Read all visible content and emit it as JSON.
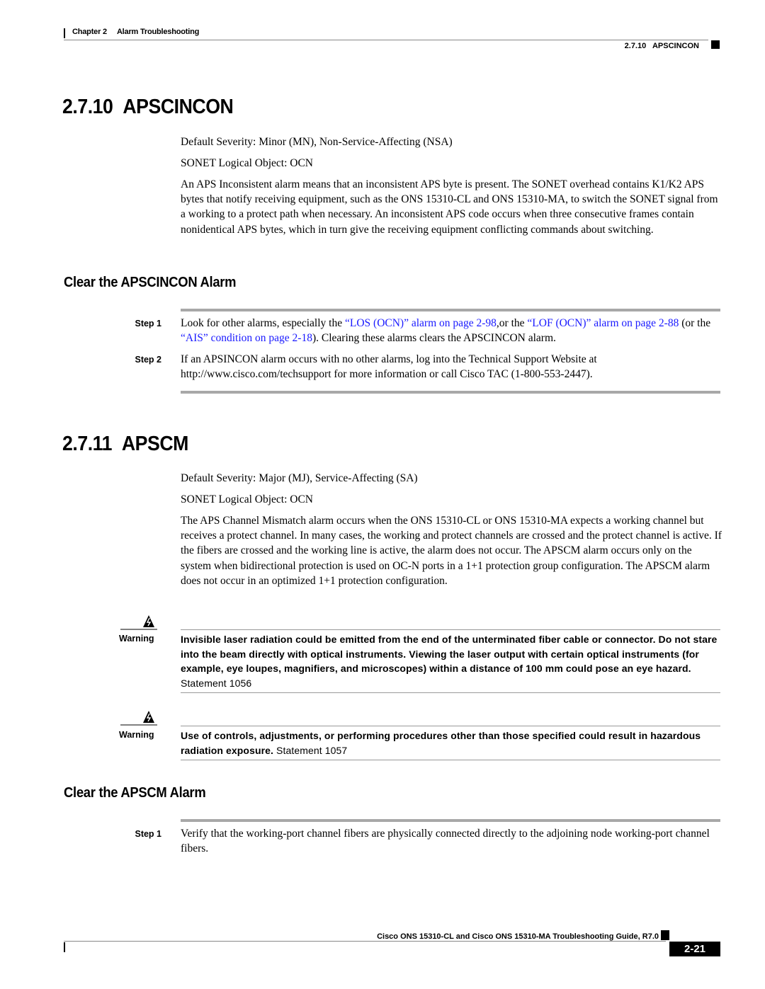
{
  "header": {
    "chapter": "Chapter 2",
    "chapter_title": "Alarm Troubleshooting",
    "running_section": "2.7.10   APSCINCON"
  },
  "sections": [
    {
      "number": "2.7.10",
      "title": "APSCINCON",
      "severity": "Default Severity: Minor (MN), Non-Service-Affecting (NSA)",
      "logical_object": "SONET Logical Object: OCN",
      "description": "An APS Inconsistent alarm means that an inconsistent APS byte is present. The SONET overhead contains K1/K2 APS bytes that notify receiving equipment, such as the ONS 15310-CL and ONS 15310-MA, to switch the SONET signal from a working to a protect path when necessary. An inconsistent APS code occurs when three consecutive frames contain nonidentical APS bytes, which in turn give the receiving equipment conflicting commands about switching.",
      "procedure": {
        "title": "Clear the APSCINCON Alarm",
        "steps": [
          {
            "label": "Step 1",
            "parts": [
              {
                "text": "Look for other alarms, especially the ",
                "link": false
              },
              {
                "text": "“LOS (OCN)” alarm on page 2-98",
                "link": true
              },
              {
                "text": ",or the ",
                "link": false
              },
              {
                "text": "“LOF (OCN)” alarm on page 2-88",
                "link": true
              },
              {
                "text": " (or the ",
                "link": false
              },
              {
                "text": "“AIS” condition on page 2-18",
                "link": true
              },
              {
                "text": "). Clearing these alarms clears the APSCINCON alarm.",
                "link": false
              }
            ]
          },
          {
            "label": "Step 2",
            "parts": [
              {
                "text": "If an APSINCON alarm occurs with no other alarms, log into the Technical Support Website at http://www.cisco.com/techsupport for more information or call Cisco TAC (1-800-553-2447).",
                "link": false
              }
            ]
          }
        ]
      }
    },
    {
      "number": "2.7.11",
      "title": "APSCM",
      "severity": "Default Severity: Major (MJ), Service-Affecting (SA)",
      "logical_object": "SONET Logical Object: OCN",
      "description": "The APS Channel Mismatch alarm occurs when the ONS 15310-CL or ONS 15310-MA expects a working channel but receives a protect channel. In many cases, the working and protect channels are crossed and the protect channel is active. If the fibers are crossed and the working line is active, the alarm does not occur. The APSCM alarm occurs only on the system when bidirectional protection is used on OC-N ports in a 1+1 protection group configuration. The APSCM alarm does not occur in an optimized 1+1 protection configuration.",
      "warnings": [
        {
          "label": "Warning",
          "icon": "warning-triangle-lightning-icon",
          "bold_text": "Invisible laser radiation could be emitted from the end of the unterminated fiber cable or connector. Do not stare into the beam directly with optical instruments. Viewing the laser output with certain optical instruments (for example, eye loupes, magnifiers, and microscopes) within a distance of 100 mm could pose an eye hazard.",
          "statement": " Statement 1056"
        },
        {
          "label": "Warning",
          "icon": "warning-triangle-lightning-icon",
          "bold_text": "Use of controls, adjustments, or performing procedures other than those specified could result in hazardous radiation exposure.",
          "statement": " Statement 1057"
        }
      ],
      "procedure": {
        "title": "Clear the APSCM Alarm",
        "steps": [
          {
            "label": "Step 1",
            "parts": [
              {
                "text": "Verify that the working-port channel fibers are physically connected directly to the adjoining node working-port channel fibers.",
                "link": false
              }
            ]
          }
        ]
      }
    }
  ],
  "footer": {
    "guide_title": "Cisco ONS 15310-CL and Cisco ONS 15310-MA Troubleshooting Guide, R7.0",
    "page_number": "2-21"
  },
  "colors": {
    "link": "#1a1aff",
    "rule": "#a8a8a8"
  }
}
